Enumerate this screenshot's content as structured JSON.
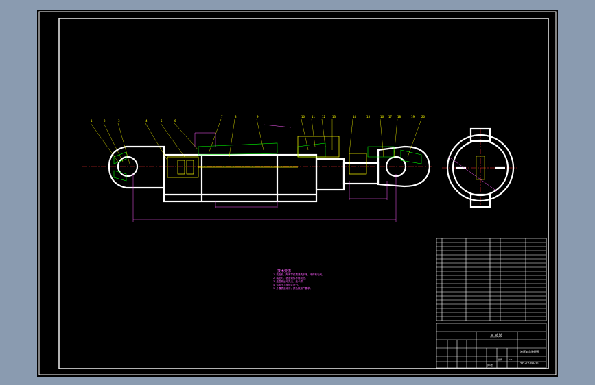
{
  "window": {
    "title": ""
  },
  "drawing": {
    "title_block": {
      "company": "某某某",
      "product_name": "液压缸总装配图",
      "drawing_number": "YYGZZ-00-00",
      "scale_label": "比例",
      "scale_value": "1:1",
      "sheet_label": "共1张"
    },
    "technical_requirements": {
      "heading": "技术要求",
      "items": [
        "1. 装配前，所有零件须清洗干净，不得有毛刺。",
        "2. 装配时，各密封件不得损伤。",
        "3. 活塞杆运动灵活，无卡滞。",
        "4. 试验压力按规定进行。",
        "5. 外露表面涂漆，颜色按用户要求。"
      ]
    },
    "bom_rows": 20,
    "balloon_labels": [
      "1",
      "2",
      "3",
      "4",
      "5",
      "6",
      "7",
      "8",
      "9",
      "10",
      "11",
      "12",
      "13",
      "14",
      "15",
      "16",
      "17",
      "18",
      "19",
      "20"
    ],
    "colors": {
      "background": "#000000",
      "frame": "#ffffff",
      "outline": "#ffffff",
      "hatch": "#00ff00",
      "center_line": "#ff0000",
      "dimension": "#ff5cff",
      "leader": "#ffff00",
      "window_bg": "#8a9bb0"
    }
  }
}
